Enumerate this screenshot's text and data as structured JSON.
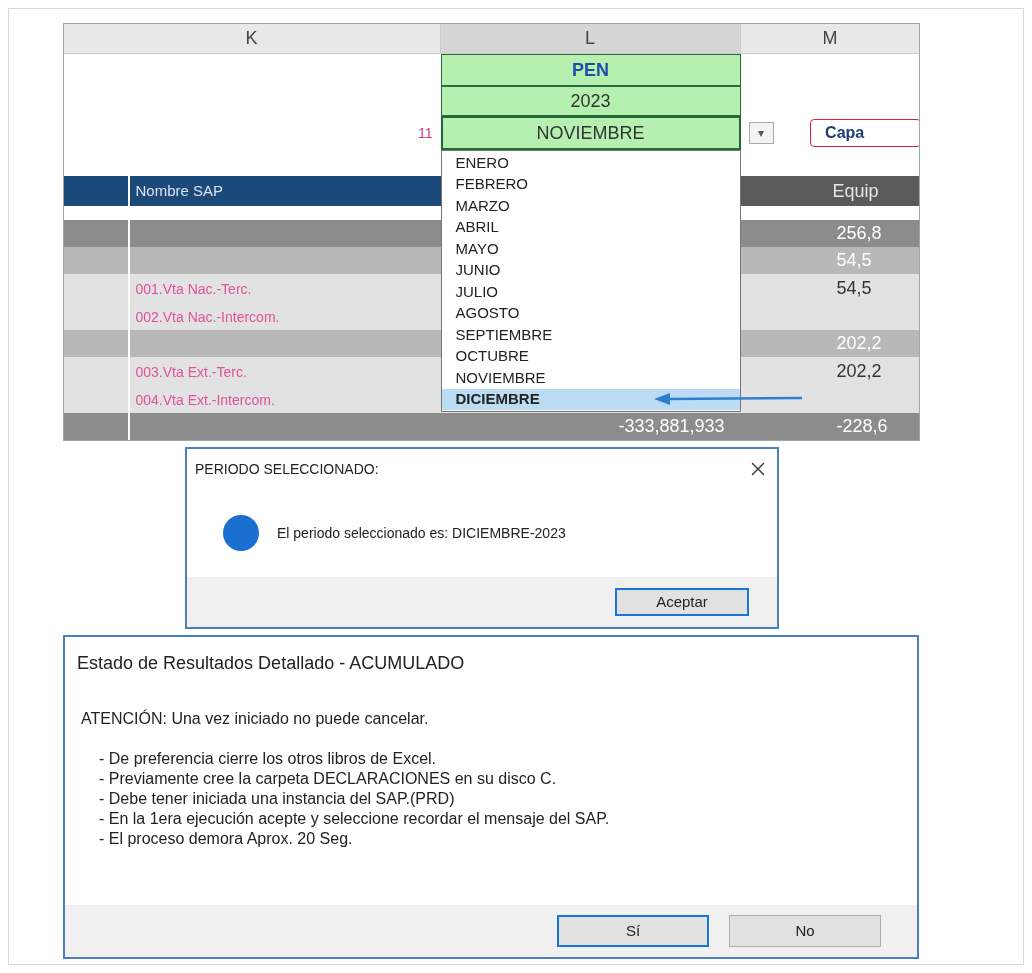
{
  "spreadsheet": {
    "columns": [
      "K",
      "L",
      "M"
    ],
    "currency": "PEN",
    "year": "2023",
    "month_number": "11",
    "month": "NOVIEMBRE",
    "dropdown_arrow": "▾",
    "capa_button": "Capa",
    "header": {
      "name_column": "Nombre SAP",
      "column_m": "Equip"
    },
    "rows": [
      {
        "kind": "blank",
        "k": "",
        "l": "",
        "m": ""
      },
      {
        "kind": "dark",
        "k": "",
        "l": "",
        "m": "256,8"
      },
      {
        "kind": "medium",
        "k": "",
        "l": "",
        "m": "54,5"
      },
      {
        "kind": "light",
        "k": "001.Vta Nac.-Terc.",
        "l": "",
        "m": "54,5"
      },
      {
        "kind": "light",
        "k": "002.Vta Nac.-Intercom.",
        "l": "",
        "m": ""
      },
      {
        "kind": "medium",
        "k": "",
        "l": "",
        "m": "202,2"
      },
      {
        "kind": "light",
        "k": "003.Vta Ext.-Terc.",
        "l": "",
        "m": "202,2"
      },
      {
        "kind": "light",
        "k": "004.Vta Ext.-Intercom.",
        "l": "",
        "m": ""
      },
      {
        "kind": "dark",
        "k": "",
        "l": "-333,881,933",
        "m": "-228,6"
      }
    ],
    "month_list": [
      {
        "label": "ENERO",
        "selected": false
      },
      {
        "label": "FEBRERO",
        "selected": false
      },
      {
        "label": "MARZO",
        "selected": false
      },
      {
        "label": "ABRIL",
        "selected": false
      },
      {
        "label": "MAYO",
        "selected": false
      },
      {
        "label": "JUNIO",
        "selected": false
      },
      {
        "label": "JULIO",
        "selected": false
      },
      {
        "label": "AGOSTO",
        "selected": false
      },
      {
        "label": "SEPTIEMBRE",
        "selected": false
      },
      {
        "label": "OCTUBRE",
        "selected": false
      },
      {
        "label": "NOVIEMBRE",
        "selected": false
      },
      {
        "label": "DICIEMBRE",
        "selected": true
      }
    ]
  },
  "period_dialog": {
    "title": "PERIODO SELECCIONADO:",
    "message": "El periodo seleccionado es: DICIEMBRE-2023",
    "buttons": [
      {
        "label": "Aceptar",
        "focused": true
      }
    ]
  },
  "confirm_dialog": {
    "title": "Estado de Resultados Detallado - ACUMULADO",
    "warning": "ATENCIÓN: Una vez iniciado no puede cancelar.",
    "notes": [
      "- De preferencia cierre los otros libros de Excel.",
      "- Previamente cree la carpeta DECLARACIONES en su disco C.",
      "- Debe tener iniciada una instancia del SAP.(PRD)",
      "- En la 1era ejecución acepte y seleccione recordar el mensaje del SAP.",
      "- El proceso demora Aprox. 20 Seg."
    ],
    "buttons": [
      {
        "label": "Sí",
        "focused": true
      },
      {
        "label": "No",
        "focused": false
      }
    ]
  }
}
